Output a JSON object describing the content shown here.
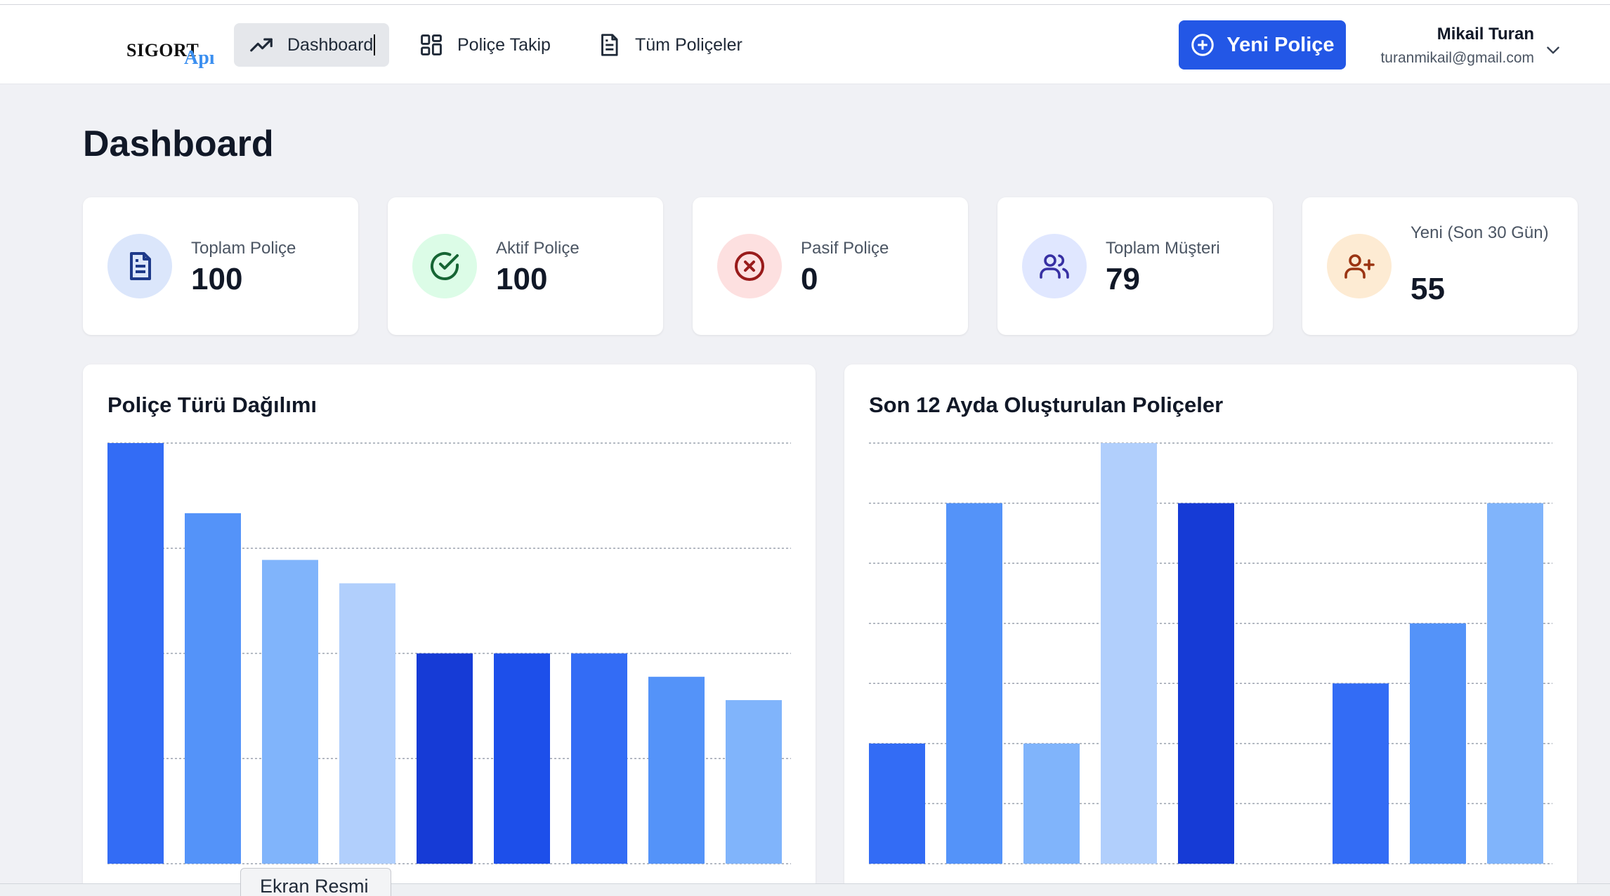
{
  "brand": {
    "logo_part1": "SIGORT",
    "logo_part2": "Apı"
  },
  "nav": {
    "items": [
      {
        "label": "Dashboard",
        "icon": "trending-up-icon",
        "active": true
      },
      {
        "label": "Poliçe Takip",
        "icon": "grid-icon",
        "active": false
      },
      {
        "label": "Tüm Poliçeler",
        "icon": "document-icon",
        "active": false
      }
    ],
    "new_button": "Yeni Poliçe"
  },
  "user": {
    "name": "Mikail Turan",
    "email": "turanmikail@gmail.com"
  },
  "page": {
    "title": "Dashboard"
  },
  "stats": [
    {
      "label": "Toplam Poliçe",
      "value": "100",
      "icon": "document-icon",
      "bg": "#dbe6fb",
      "fg": "#1e3a8a"
    },
    {
      "label": "Aktif Poliçe",
      "value": "100",
      "icon": "check-circle-icon",
      "bg": "#dcfce7",
      "fg": "#166534"
    },
    {
      "label": "Pasif Poliçe",
      "value": "0",
      "icon": "x-circle-icon",
      "bg": "#fde0e0",
      "fg": "#991b1b"
    },
    {
      "label": "Toplam Müşteri",
      "value": "79",
      "icon": "users-icon",
      "bg": "#e0e7ff",
      "fg": "#3730a3"
    },
    {
      "label": "Yeni (Son 30 Gün)",
      "value": "55",
      "icon": "user-plus-icon",
      "bg": "#fdebd3",
      "fg": "#9a3412"
    }
  ],
  "chart_data": [
    {
      "type": "bar",
      "title": "Poliçe Türü Dağılımı",
      "values": [
        18,
        15,
        13,
        12,
        9,
        9,
        9,
        8,
        7
      ],
      "ylim": [
        0,
        18
      ],
      "colors": [
        "#336cf5",
        "#5493f9",
        "#80b4fb",
        "#b1cffc",
        "#163bd6",
        "#1d4fea",
        "#336cf5",
        "#5493f9",
        "#80b4fb"
      ],
      "grid": true
    },
    {
      "type": "bar",
      "title": "Son 12 Ayda Oluşturulan Poliçeler",
      "values": [
        2,
        6,
        2,
        7,
        6,
        0,
        3,
        4,
        6
      ],
      "ylim": [
        0,
        7
      ],
      "colors": [
        "#336cf5",
        "#5493f9",
        "#80b4fb",
        "#b1cffc",
        "#163bd6",
        "#1d4fea",
        "#336cf5",
        "#5493f9",
        "#80b4fb"
      ],
      "grid": true
    }
  ],
  "tooltip": {
    "text": "Ekran Resmi"
  }
}
